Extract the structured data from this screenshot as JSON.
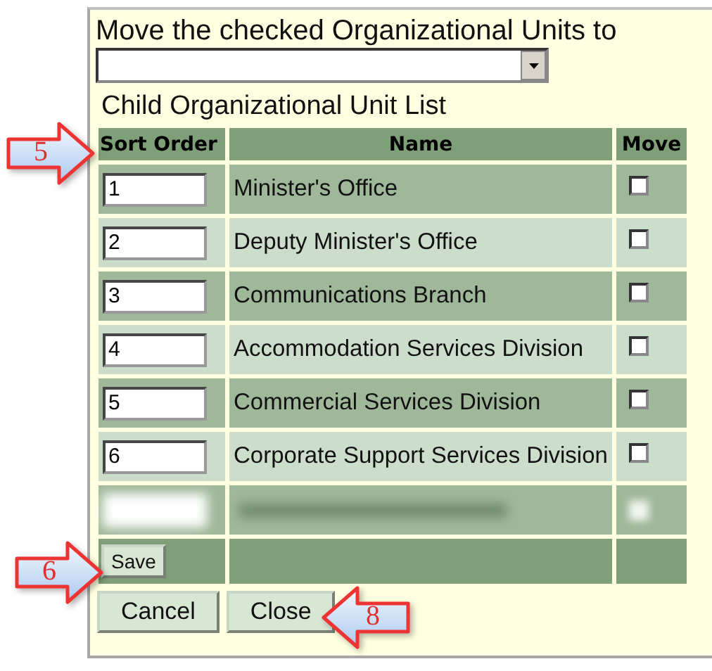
{
  "move_label": "Move the checked Organizational Units to",
  "list_title": "Child Organizational Unit List",
  "table": {
    "columns": [
      "Sort Order",
      "Name",
      "Move"
    ],
    "rows": [
      {
        "kind": "unit",
        "sort_order": "1",
        "name": "Minister's Office",
        "checked": false
      },
      {
        "kind": "unit",
        "sort_order": "2",
        "name": "Deputy Minister's Office",
        "checked": false
      },
      {
        "kind": "unit",
        "sort_order": "3",
        "name": "Communications Branch",
        "checked": false
      },
      {
        "kind": "unit",
        "sort_order": "4",
        "name": "Accommodation Services Division",
        "checked": false
      },
      {
        "kind": "unit",
        "sort_order": "5",
        "name": "Commercial Services Division",
        "checked": false
      },
      {
        "kind": "unit",
        "sort_order": "6",
        "name": "Corporate Support Services Division",
        "checked": false
      },
      {
        "kind": "blurred"
      }
    ],
    "save_button": "Save"
  },
  "buttons": [
    "Cancel",
    "Close"
  ],
  "callouts": [
    {
      "number": "5",
      "kind": "right"
    },
    {
      "number": "6",
      "kind": "right"
    },
    {
      "number": "8",
      "kind": "left"
    }
  ]
}
